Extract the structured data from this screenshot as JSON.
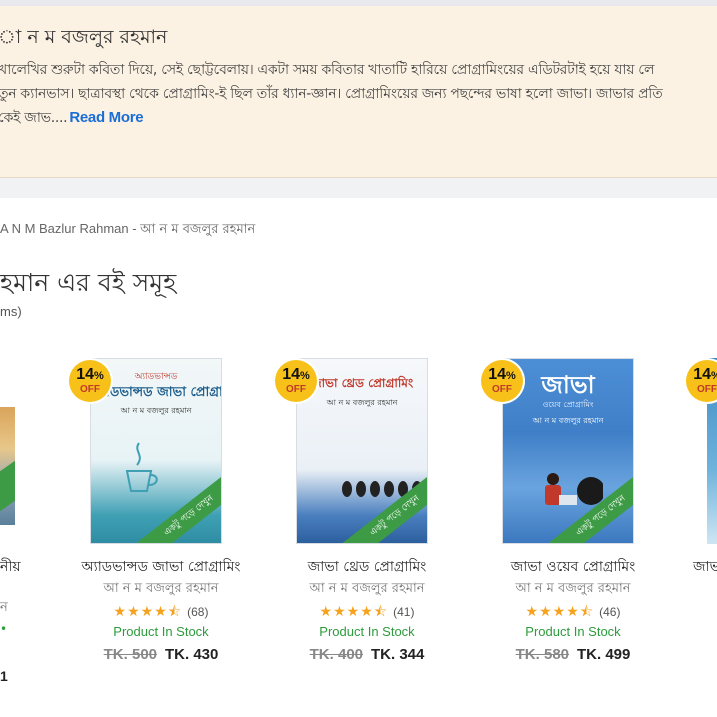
{
  "bio": {
    "name": "া ন ম বজলুর রহমান",
    "line1": "খালেখির শুরুটা কবিতা দিয়ে, সেই ছোট্টবেলায়। একটা সময় কবিতার খাতাটি হারিয়ে প্রোগ্রামিংয়ের এডিটরটাই হয়ে যায় লে",
    "line2": "তুন ক্যানভাস। ছাত্রাবস্থা থেকে প্রোগ্রামিং-ই ছিল তাঁর ধ্যান-জ্ঞান। প্রোগ্রামিংয়ের জন্য পছন্দের ভাষা হলো জাভা। জাভার প্রতি",
    "line3": "কেই জাভ....",
    "read_more": "Read More"
  },
  "breadcrumb": {
    "latin": "A N M Bazlur Rahman - ",
    "bengali": "আ ন ম বজলুর রহমান"
  },
  "section": {
    "title": "হমান এর বই সমূহ",
    "count": "ms)"
  },
  "badge": {
    "pct": "14",
    "pct_sign": "%",
    "off": "OFF"
  },
  "read_ribbon": "একটু পড়ে দেখুন",
  "partial_left": {
    "title": "নীয়",
    "author": "ন",
    "stock": "•",
    "price": "1"
  },
  "books": [
    {
      "title": "অ্যাডভান্সড জাভা প্রোগ্রামিং",
      "author": "আ ন ম বজলুর রহমান",
      "stars": "★★★★⯪",
      "reviews": "(68)",
      "stock": "Product In Stock",
      "old_price": "TK. 500",
      "price": "TK. 430",
      "cover_title": "অ্যাডভান্সড জাভা প্রোগ্রামিং",
      "cover_author": "আ ন ম বজলুর রহমান"
    },
    {
      "title": "জাভা থ্রেড প্রোগ্রামিং",
      "author": "আ ন ম বজলুর রহমান",
      "stars": "★★★★⯪",
      "reviews": "(41)",
      "stock": "Product In Stock",
      "old_price": "TK. 400",
      "price": "TK. 344",
      "cover_title": "জাভা থ্রেড প্রোগ্রামিং",
      "cover_author": "আ ন ম বজলুর রহমান"
    },
    {
      "title": "জাভা ওয়েব প্রোগ্রামিং",
      "author": "আ ন ম বজলুর রহমান",
      "stars": "★★★★⯪",
      "reviews": "(46)",
      "stock": "Product In Stock",
      "old_price": "TK. 580",
      "price": "TK. 499",
      "cover_title": "জাভা",
      "cover_subtitle": "ওয়েব প্রোগ্রামিং",
      "cover_author": "আ ন ম বজলুর রহমান"
    }
  ],
  "partial_right": {
    "title": "জাভ"
  },
  "colors": {
    "bio_bg": "#fcf2e3",
    "link": "#1a6dd6",
    "in_stock": "#2c9c3c",
    "star": "#f6a21d",
    "badge": "#f7c11a",
    "ribbon": "#3d9b46"
  }
}
